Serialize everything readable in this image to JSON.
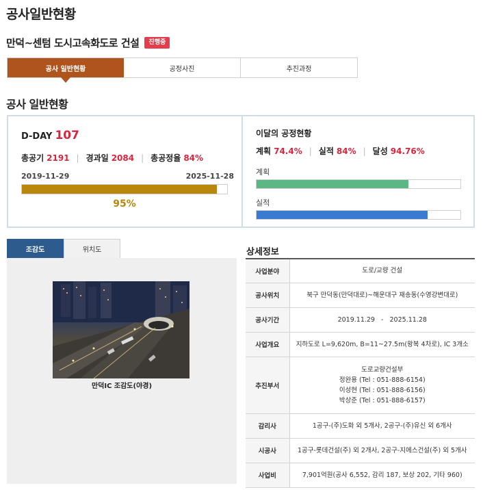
{
  "page": {
    "title": "공사일반현황"
  },
  "project": {
    "name": "만덕~센텀 도시고속화도로 건설",
    "status": "진행중"
  },
  "tabs": [
    {
      "label": "공사 일반현황",
      "active": true
    },
    {
      "label": "공정사진",
      "active": false
    },
    {
      "label": "추진과정",
      "active": false
    }
  ],
  "section_title": "공사 일반현황",
  "summary": {
    "dday_label": "D-DAY",
    "dday_value": "107",
    "total_label": "총공기",
    "total_value": "2191",
    "elapsed_label": "경과일",
    "elapsed_value": "2084",
    "rate_label": "총공정율",
    "rate_value": "84%",
    "start_date": "2019-11-29",
    "end_date": "2025-11-28",
    "time_progress": 95,
    "time_progress_text": "95%"
  },
  "monthly": {
    "title": "이달의 공정현황",
    "plan_label": "계획",
    "plan_value": "74.4%",
    "actual_label": "실적",
    "actual_value": "84%",
    "achieve_label": "달성",
    "achieve_value": "94.76%",
    "plan_bar_label": "계획",
    "plan_bar_value": 74.4,
    "actual_bar_label": "실적",
    "actual_bar_value": 84,
    "plan_color": "#5bb783",
    "actual_color": "#3b7ad1"
  },
  "view_tabs": [
    {
      "label": "조감도",
      "active": true
    },
    {
      "label": "위치도",
      "active": false
    }
  ],
  "photo": {
    "caption": "만덕IC 조감도(야경)"
  },
  "detail": {
    "title": "상세정보",
    "rows": [
      {
        "label": "사업분야",
        "lines": [
          "도로/교량 건설"
        ]
      },
      {
        "label": "공사위치",
        "lines": [
          "북구 만덕동(만덕대로)~해운대구 재송동(수영강변대로)"
        ]
      },
      {
        "label": "공사기간",
        "lines": [
          "2019.11.29   -   2025.11.28"
        ]
      },
      {
        "label": "사업개요",
        "lines": [
          "지하도로 L=9,620m, B=11~27.5m(왕복 4차로), IC 3개소"
        ]
      },
      {
        "label": "추진부서",
        "lines": [
          "도로교량건설부",
          "정완용 (Tel : 051-888-6154)",
          "이성현 (Tel : 051-888-6156)",
          "박상준 (Tel : 051-888-6157)"
        ]
      },
      {
        "label": "감리사",
        "lines": [
          "1공구-(주)도화 외 5개사, 2공구-(주)유신 외 6개사"
        ]
      },
      {
        "label": "시공사",
        "lines": [
          "1공구-롯데건설(주) 외 2개사, 2공구-지에스건설(주) 외 5개사"
        ]
      },
      {
        "label": "사업비",
        "lines": [
          "7,901억원(공사 6,552, 감리 187, 보상 202, 기타 960)"
        ]
      }
    ]
  }
}
